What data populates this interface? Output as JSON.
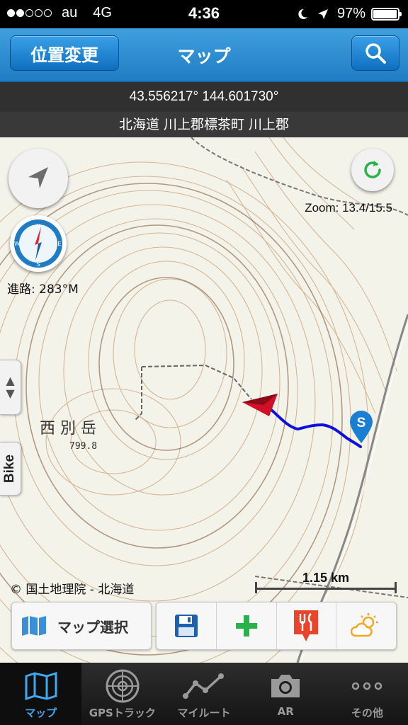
{
  "status_bar": {
    "carrier": "au",
    "network": "4G",
    "time": "4:36",
    "battery_text": "97%",
    "battery_level": 0.97,
    "signal_bars_filled": 2,
    "signal_bars_total": 5
  },
  "nav": {
    "left_button_label": "位置変更",
    "title": "マップ",
    "right_icon": "search-icon"
  },
  "info": {
    "coordinates": "43.556217° 144.601730°",
    "address": "北海道 川上郡標茶町 川上郡"
  },
  "map": {
    "zoom_label": "Zoom: 13.4/15.5",
    "heading_label": "進路: 283°M",
    "attribution": "© 国土地理院 - 北海道",
    "scale_label": "1.15 km",
    "side_tab_label": "Bike",
    "start_marker_letter": "S",
    "mountain_name": "西 別 岳",
    "elevation": "799.8",
    "track_color": "#1010dd",
    "heading_arrow_color": "#d01026"
  },
  "toolbar": {
    "map_select_label": "マップ選択",
    "tools": [
      "save-icon",
      "add-icon",
      "restaurant-icon",
      "weather-icon"
    ]
  },
  "tabs": [
    {
      "label": "マップ",
      "icon": "map-icon",
      "active": true
    },
    {
      "label": "GPSトラック",
      "icon": "radar-icon",
      "active": false
    },
    {
      "label": "マイルート",
      "icon": "route-icon",
      "active": false
    },
    {
      "label": "AR",
      "icon": "camera-icon",
      "active": false
    },
    {
      "label": "その他",
      "icon": "more-icon",
      "active": false
    }
  ],
  "colors": {
    "nav_blue": "#2a8ad3",
    "tab_active": "#3ea8f2",
    "add_green": "#27b24a",
    "restaurant_red": "#e8452c",
    "weather_orange": "#f5a623"
  }
}
